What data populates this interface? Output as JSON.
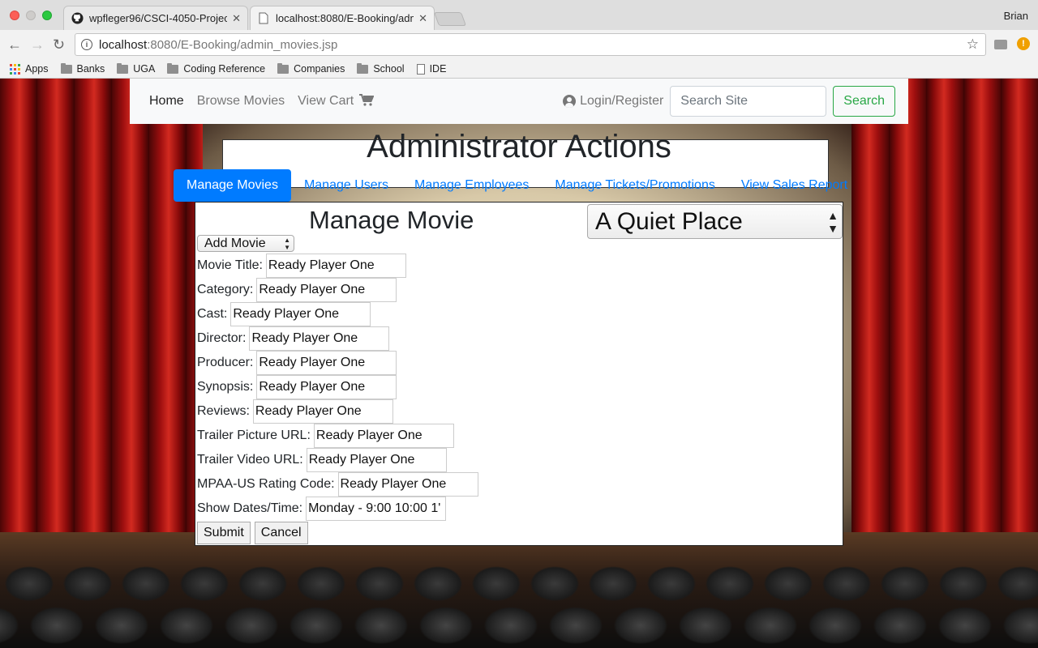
{
  "browser": {
    "tabs": [
      {
        "title": "wpfleger96/CSCI-4050-Projec",
        "icon": "github-icon"
      },
      {
        "title": "localhost:8080/E-Booking/adm",
        "icon": "page-icon"
      }
    ],
    "profile_name": "Brian",
    "url_host": "localhost",
    "url_rest": ":8080/E-Booking/admin_movies.jsp",
    "bookmarks": [
      "Apps",
      "Banks",
      "UGA",
      "Coding Reference",
      "Companies",
      "School",
      "IDE"
    ]
  },
  "navbar": {
    "links": [
      "Home",
      "Browse Movies",
      "View Cart"
    ],
    "login_label": "Login/Register",
    "search_placeholder": "Search Site",
    "search_button": "Search"
  },
  "admin": {
    "title": "Administrator Actions",
    "tabs": [
      "Manage Movies",
      "Manage Users",
      "Manage Employees",
      "Manage Tickets/Promotions",
      "View Sales Report"
    ],
    "active_tab": "Manage Movies"
  },
  "manage_movie": {
    "title": "Manage Movie",
    "selected_movie": "A Quiet Place",
    "action": "Add Movie",
    "fields": [
      {
        "label": "Movie Title:",
        "value": "Ready Player One"
      },
      {
        "label": "Category:",
        "value": "Ready Player One"
      },
      {
        "label": "Cast:",
        "value": "Ready Player One"
      },
      {
        "label": "Director:",
        "value": "Ready Player One"
      },
      {
        "label": "Producer:",
        "value": "Ready Player One"
      },
      {
        "label": "Synopsis:",
        "value": "Ready Player One"
      },
      {
        "label": "Reviews:",
        "value": "Ready Player One"
      },
      {
        "label": "Trailer Picture URL:",
        "value": "Ready Player One"
      },
      {
        "label": "Trailer Video URL:",
        "value": "Ready Player One"
      },
      {
        "label": "MPAA-US Rating Code:",
        "value": "Ready Player One"
      },
      {
        "label": "Show Dates/Time:",
        "value": "Monday - 9:00 10:00 1'"
      }
    ],
    "submit_label": "Submit",
    "cancel_label": "Cancel"
  }
}
